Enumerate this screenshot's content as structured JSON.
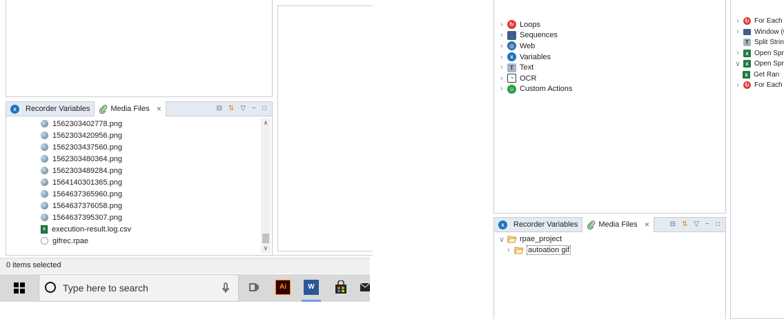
{
  "left": {
    "tabs": [
      {
        "label": "Recorder Variables",
        "active": false
      },
      {
        "label": "Media Files",
        "active": true,
        "close": "✕"
      }
    ],
    "files": [
      {
        "name": "1562303402778.png",
        "type": "png"
      },
      {
        "name": "1562303420956.png",
        "type": "png"
      },
      {
        "name": "1562303437560.png",
        "type": "png"
      },
      {
        "name": "1562303480364.png",
        "type": "png"
      },
      {
        "name": "1562303489284.png",
        "type": "png"
      },
      {
        "name": "1564140301365.png",
        "type": "png"
      },
      {
        "name": "1564637365960.png",
        "type": "png"
      },
      {
        "name": "1564637376058.png",
        "type": "png"
      },
      {
        "name": "1564637395307.png",
        "type": "png"
      },
      {
        "name": "execution-result.log.csv",
        "type": "csv"
      },
      {
        "name": "gifrec.rpae",
        "type": "rpae"
      }
    ],
    "status": "0 items selected",
    "taskbar": {
      "search_placeholder": "Type here to search"
    }
  },
  "right": {
    "palette": [
      {
        "label": "Loops",
        "icon": "loops-icon",
        "color": "#e53935"
      },
      {
        "label": "Sequences",
        "icon": "sequences-icon",
        "color": "#3f5f8a"
      },
      {
        "label": "Web",
        "icon": "web-icon",
        "color": "#2f6db5"
      },
      {
        "label": "Variables",
        "icon": "variables-icon",
        "color": "#1e73be"
      },
      {
        "label": "Text",
        "icon": "text-icon",
        "color": "#7a8a9a"
      },
      {
        "label": "OCR",
        "icon": "ocr-icon",
        "color": "#333333"
      },
      {
        "label": "Custom Actions",
        "icon": "custom-actions-icon",
        "color": "#2e9d47"
      }
    ],
    "outline": [
      {
        "label": "For Each (",
        "icon": "loop-icon"
      },
      {
        "label": "Window (C",
        "icon": "window-icon"
      },
      {
        "label": "Split String",
        "icon": "split-icon"
      },
      {
        "label": "Open Spre",
        "icon": "excel-icon"
      },
      {
        "label": "Open Spre",
        "icon": "excel-icon"
      },
      {
        "label": "Get Ran",
        "icon": "excel-icon"
      },
      {
        "label": "For Each (",
        "icon": "loop-icon"
      }
    ],
    "tabs": [
      {
        "label": "Recorder Variables",
        "active": false
      },
      {
        "label": "Media Files",
        "active": true,
        "close": "✕"
      }
    ],
    "tree": [
      {
        "label": "rpae_project",
        "expanded": true
      },
      {
        "label": "autoation gif",
        "expanded": false
      }
    ]
  }
}
